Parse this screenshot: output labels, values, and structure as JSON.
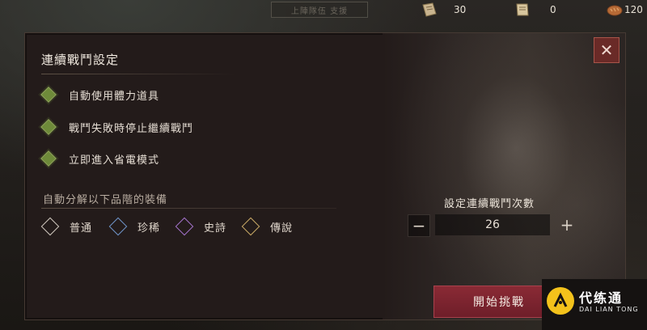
{
  "topbar": {
    "tab_label": "上陣隊伍 支援",
    "resources": [
      {
        "icon": "map-scroll-icon",
        "value": "30"
      },
      {
        "icon": "map-scroll-icon",
        "value": "0"
      },
      {
        "icon": "bread-icon",
        "value": "120"
      }
    ]
  },
  "dialog": {
    "title": "連續戰鬥設定",
    "options": [
      {
        "label": "自動使用體力道具",
        "checked": true
      },
      {
        "label": "戰鬥失敗時停止繼續戰鬥",
        "checked": true
      },
      {
        "label": "立即進入省電模式",
        "checked": true
      }
    ],
    "dismantle": {
      "label": "自動分解以下品階的裝備",
      "rarities": [
        {
          "label": "普通",
          "color": "#cfc7bd"
        },
        {
          "label": "珍稀",
          "color": "#6e93c7"
        },
        {
          "label": "史詩",
          "color": "#a272c9"
        },
        {
          "label": "傳說",
          "color": "#c7a865"
        }
      ]
    },
    "battle_count": {
      "label": "設定連續戰鬥次數",
      "value": "26",
      "minus": "−",
      "plus": "+"
    },
    "start_button": "開始挑戰",
    "close_symbol": "✕"
  },
  "watermark": {
    "text": "代练通",
    "sub": "DAI LIAN TONG"
  },
  "colors": {
    "check_green": "#6e8a3a",
    "start_red": "#7d2430",
    "close_red": "#6a2a27"
  }
}
